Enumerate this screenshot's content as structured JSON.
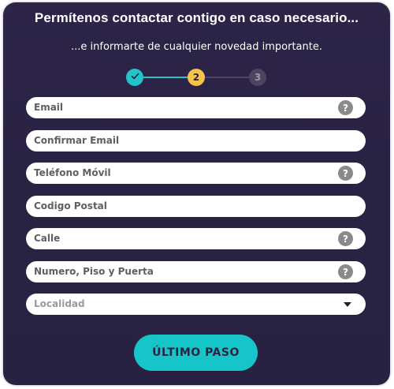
{
  "header": {
    "title": "Permítenos contactar contigo en caso necesario...",
    "subtitle": "...e informarte de cualquier novedad importante."
  },
  "stepper": {
    "steps": [
      {
        "label": "",
        "state": "completed",
        "icon": "check-icon"
      },
      {
        "label": "2",
        "state": "current"
      },
      {
        "label": "3",
        "state": "pending"
      }
    ]
  },
  "form": {
    "fields": [
      {
        "placeholder": "Email",
        "help": "?"
      },
      {
        "placeholder": "Confirmar Email"
      },
      {
        "placeholder": "Teléfono Móvil",
        "help": "?"
      },
      {
        "placeholder": "Codigo Postal"
      },
      {
        "placeholder": "Calle",
        "help": "?"
      },
      {
        "placeholder": "Numero, Piso y Puerta",
        "help": "?"
      },
      {
        "placeholder": "Localidad",
        "type": "select"
      }
    ],
    "submit_label": "ÚLTIMO PASO"
  },
  "colors": {
    "background": "#2a2243",
    "accent": "#16c5c8",
    "step_current": "#f5c24a",
    "step_pending": "#4b4560"
  }
}
